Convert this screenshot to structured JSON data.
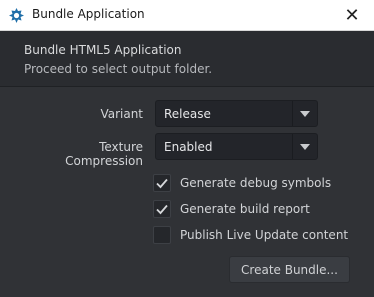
{
  "window": {
    "title": "Bundle Application",
    "close_symbol": "✕"
  },
  "header": {
    "title": "Bundle HTML5 Application",
    "subtitle": "Proceed to select output folder."
  },
  "form": {
    "variant": {
      "label": "Variant",
      "value": "Release"
    },
    "texture_compression": {
      "label": "Texture Compression",
      "value": "Enabled"
    },
    "options": [
      {
        "label": "Generate debug symbols",
        "checked": true
      },
      {
        "label": "Generate build report",
        "checked": true
      },
      {
        "label": "Publish Live Update content",
        "checked": false
      }
    ]
  },
  "actions": {
    "create_label": "Create Bundle..."
  },
  "colors": {
    "background": "#303236",
    "header": "#2a2c30",
    "titlebar": "#ffffff",
    "logo": "#1f6ea8"
  }
}
